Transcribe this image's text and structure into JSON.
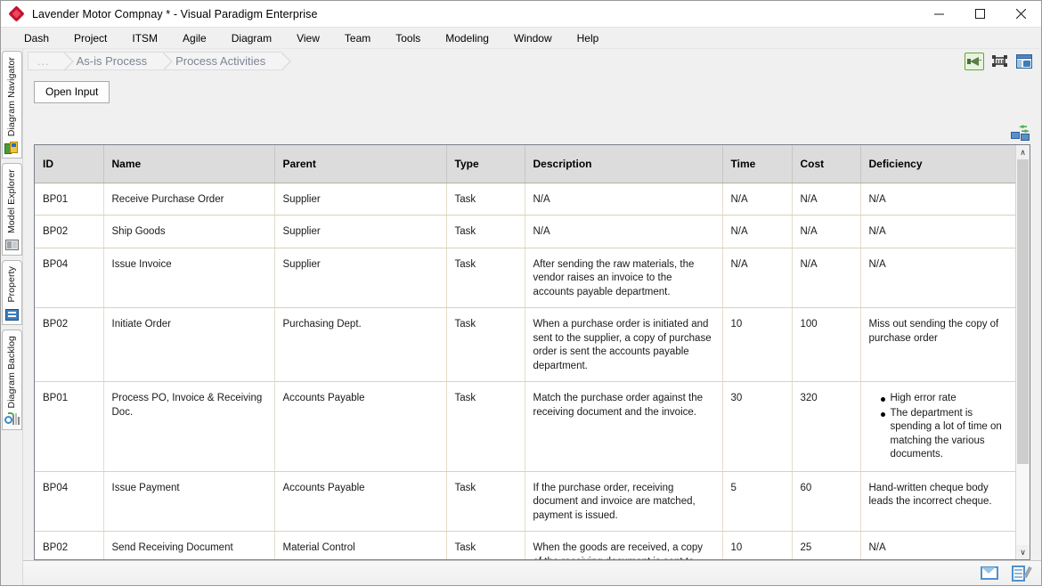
{
  "window": {
    "title": "Lavender Motor Compnay * - Visual Paradigm Enterprise",
    "logo_icon": "red-diamond-logo",
    "minimize_label": "—",
    "maximize_label": "□",
    "close_label": "✕"
  },
  "menubar": {
    "items": [
      {
        "label": "Dash"
      },
      {
        "label": "Project"
      },
      {
        "label": "ITSM"
      },
      {
        "label": "Agile"
      },
      {
        "label": "Diagram"
      },
      {
        "label": "View"
      },
      {
        "label": "Team"
      },
      {
        "label": "Tools"
      },
      {
        "label": "Modeling"
      },
      {
        "label": "Window"
      },
      {
        "label": "Help"
      }
    ]
  },
  "sidebar": {
    "tabs": [
      {
        "label": "Diagram Navigator",
        "icon": "diagram-navigator-icon"
      },
      {
        "label": "Model Explorer",
        "icon": "model-explorer-icon"
      },
      {
        "label": "Property",
        "icon": "property-icon"
      },
      {
        "label": "Diagram Backlog",
        "icon": "diagram-backlog-icon"
      }
    ]
  },
  "breadcrumb": {
    "items": [
      {
        "label": "..."
      },
      {
        "label": "As-is Process"
      },
      {
        "label": "Process Activities"
      }
    ]
  },
  "crumb_tools": [
    {
      "icon": "megaphone-icon",
      "selected": true
    },
    {
      "icon": "frame-select-icon",
      "selected": false
    },
    {
      "icon": "panel-window-icon",
      "selected": false
    }
  ],
  "toolbar": {
    "open_input_label": "Open Input",
    "sync_icon": "sync-diagram-icon"
  },
  "table": {
    "columns": [
      {
        "key": "id",
        "label": "ID"
      },
      {
        "key": "name",
        "label": "Name"
      },
      {
        "key": "parent",
        "label": "Parent"
      },
      {
        "key": "type",
        "label": "Type"
      },
      {
        "key": "description",
        "label": "Description"
      },
      {
        "key": "time",
        "label": "Time"
      },
      {
        "key": "cost",
        "label": "Cost"
      },
      {
        "key": "deficiency",
        "label": "Deficiency"
      }
    ],
    "rows": [
      {
        "id": "BP01",
        "name": "Receive Purchase Order",
        "parent": "Supplier",
        "type": "Task",
        "description": "N/A",
        "time": "N/A",
        "cost": "N/A",
        "deficiency": "N/A",
        "deficiency_bullets": []
      },
      {
        "id": "BP02",
        "name": "Ship Goods",
        "parent": "Supplier",
        "type": "Task",
        "description": "N/A",
        "time": "N/A",
        "cost": "N/A",
        "deficiency": "N/A",
        "deficiency_bullets": []
      },
      {
        "id": "BP04",
        "name": "Issue Invoice",
        "parent": "Supplier",
        "type": "Task",
        "description": "After sending the raw materials, the vendor raises an invoice to the accounts payable department.",
        "time": "N/A",
        "cost": "N/A",
        "deficiency": "N/A",
        "deficiency_bullets": []
      },
      {
        "id": "BP02",
        "name": "Initiate Order",
        "parent": "Purchasing Dept.",
        "type": "Task",
        "description": "When a purchase order is initiated and sent to the supplier, a copy of purchase order is sent the accounts payable department.",
        "time": "10",
        "cost": "100",
        "deficiency": "Miss out sending the copy of purchase order",
        "deficiency_bullets": []
      },
      {
        "id": "BP01",
        "name": "Process PO, Invoice & Receiving Doc.",
        "parent": "Accounts Payable",
        "type": "Task",
        "description": "Match the purchase order against the receiving document and the invoice.",
        "time": "30",
        "cost": "320",
        "deficiency": "",
        "deficiency_bullets": [
          "High error rate",
          "The department is spending a lot of time on matching the various documents."
        ]
      },
      {
        "id": "BP04",
        "name": "Issue Payment",
        "parent": "Accounts Payable",
        "type": "Task",
        "description": "If the purchase order, receiving document and invoice are matched, payment is issued.",
        "time": "5",
        "cost": "60",
        "deficiency": "Hand-written cheque body leads the incorrect cheque.",
        "deficiency_bullets": []
      },
      {
        "id": "BP02",
        "name": "Send Receiving Document",
        "parent": "Material Control",
        "type": "Task",
        "description": "When the goods are received, a copy of the receiving document is sent to accounts payable.",
        "time": "10",
        "cost": "25",
        "deficiency": "N/A",
        "deficiency_bullets": []
      }
    ],
    "scrollbar": {
      "up_label": "∧",
      "down_label": "∨",
      "thumb_percent": "79"
    }
  },
  "statusbar": {
    "icons": [
      {
        "icon": "mail-icon"
      },
      {
        "icon": "document-edit-icon"
      }
    ]
  },
  "colors": {
    "accent": "#4a86c8",
    "header_bg": "#dcdcdc",
    "grid_line": "#e3ddc8",
    "selected_border": "#5fa832",
    "logo": "#c4122f"
  }
}
